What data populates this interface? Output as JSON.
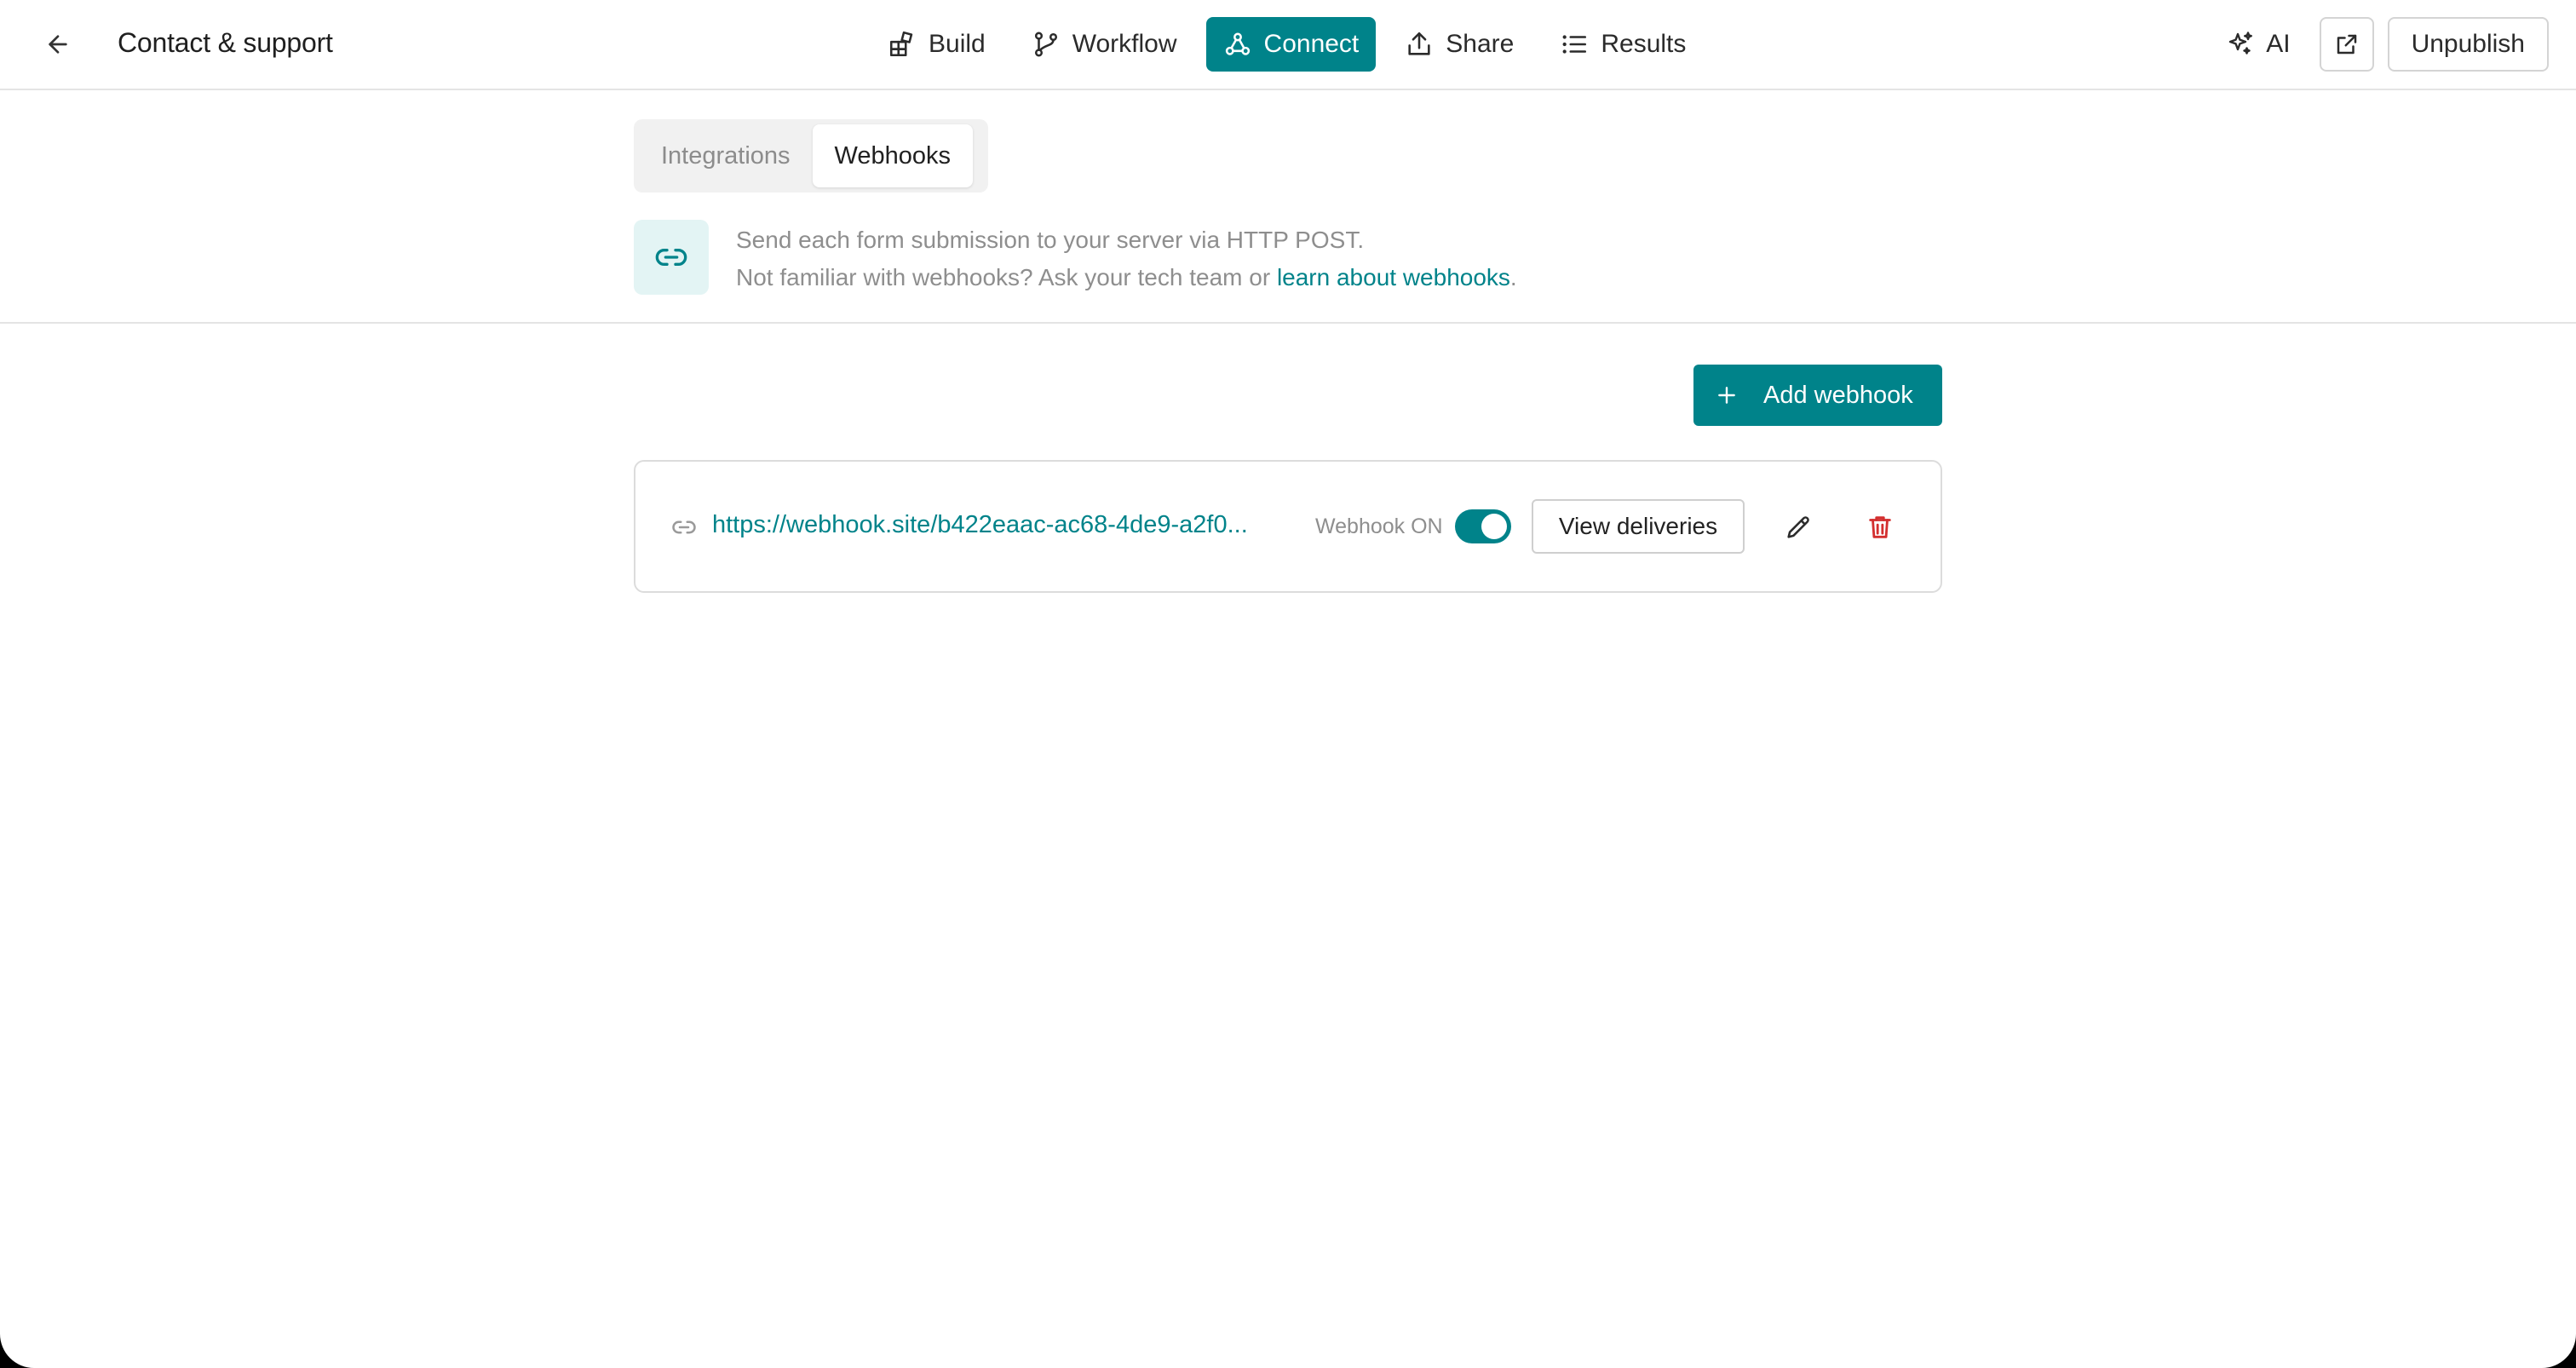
{
  "header": {
    "title": "Contact & support",
    "nav": [
      {
        "label": "Build",
        "icon": "build-icon"
      },
      {
        "label": "Workflow",
        "icon": "workflow-icon"
      },
      {
        "label": "Connect",
        "icon": "connect-icon",
        "active": true
      },
      {
        "label": "Share",
        "icon": "share-icon"
      },
      {
        "label": "Results",
        "icon": "results-icon"
      }
    ],
    "ai_label": "AI",
    "unpublish_label": "Unpublish"
  },
  "tabs": [
    {
      "label": "Integrations",
      "active": false
    },
    {
      "label": "Webhooks",
      "active": true
    }
  ],
  "info": {
    "line1": "Send each form submission to your server via HTTP POST.",
    "line2_prefix": "Not familiar with webhooks? Ask your tech team or ",
    "link_text": "learn about webhooks",
    "line2_suffix": "."
  },
  "add_button_label": "Add webhook",
  "webhooks": [
    {
      "url": "https://webhook.site/b422eaac-ac68-4de9-a2f0...",
      "status_label": "Webhook ON",
      "enabled": true,
      "view_label": "View deliveries"
    }
  ],
  "colors": {
    "accent": "#00838a",
    "accent_light": "#e3f4f4",
    "danger": "#d32f2f"
  }
}
